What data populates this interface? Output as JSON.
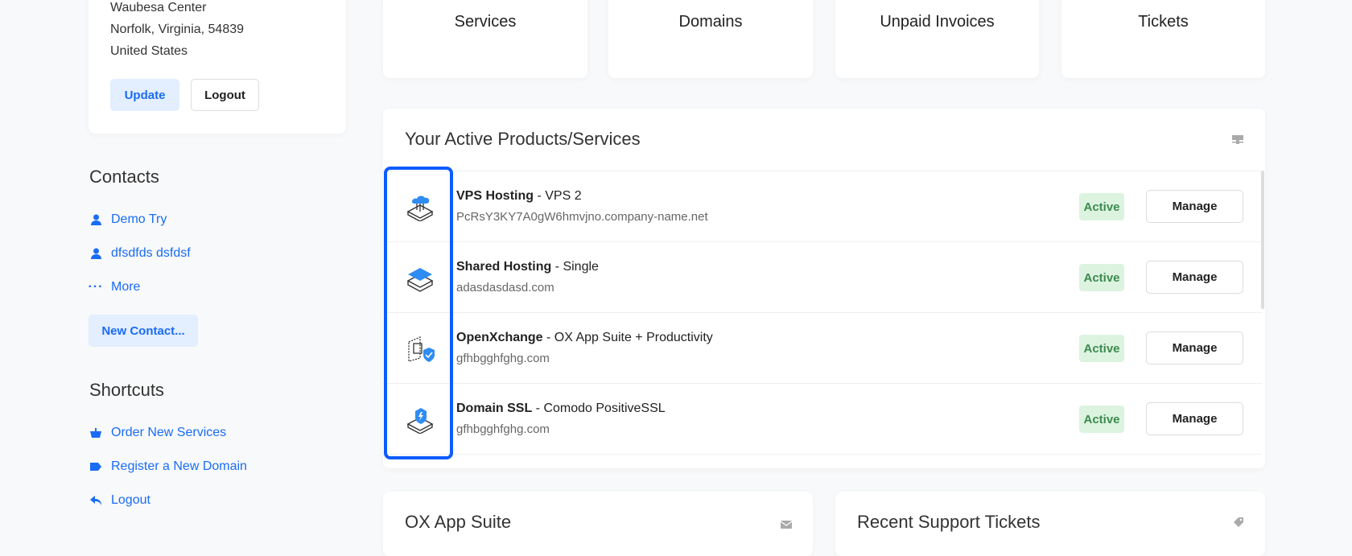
{
  "account": {
    "address_lines": [
      "Waubesa Center",
      "Norfolk, Virginia, 54839",
      "United States"
    ],
    "update_label": "Update",
    "logout_label": "Logout"
  },
  "contacts": {
    "title": "Contacts",
    "items": [
      "Demo Try",
      "dfsdfds dsfdsf"
    ],
    "more_label": "More",
    "new_contact_label": "New Contact..."
  },
  "shortcuts": {
    "title": "Shortcuts",
    "items": [
      "Order New Services",
      "Register a New Domain",
      "Logout"
    ]
  },
  "stats": [
    {
      "label": "Services",
      "color": "#1a6cf5"
    },
    {
      "label": "Domains",
      "color": "#1a6cf5"
    },
    {
      "label": "Unpaid Invoices",
      "color": "#e53935"
    },
    {
      "label": "Tickets",
      "color": "#1a6cf5"
    }
  ],
  "products": {
    "title": "Your Active Products/Services",
    "items": [
      {
        "name": "VPS Hosting",
        "plan": " - VPS 2",
        "domain": "PcRsY3KY7A0gW6hmvjno.company-name.net",
        "status": "Active",
        "action": "Manage",
        "icon": "vps-icon"
      },
      {
        "name": "Shared Hosting",
        "plan": " - Single",
        "domain": "adasdasdasd.com",
        "status": "Active",
        "action": "Manage",
        "icon": "shared-hosting-icon"
      },
      {
        "name": "OpenXchange",
        "plan": " - OX App Suite + Productivity",
        "domain": "gfhbgghfghg.com",
        "status": "Active",
        "action": "Manage",
        "icon": "openxchange-icon"
      },
      {
        "name": "Domain SSL",
        "plan": " - Comodo PositiveSSL",
        "domain": "gfhbgghfghg.com",
        "status": "Active",
        "action": "Manage",
        "icon": "ssl-icon"
      }
    ]
  },
  "ox_panel": {
    "title": "OX App Suite"
  },
  "tickets_panel": {
    "title": "Recent Support Tickets"
  },
  "colors": {
    "accent": "#1a6cf5",
    "highlight": "#0d5cff",
    "active_bg": "#dcf3e0",
    "active_text": "#3c8a4e"
  }
}
